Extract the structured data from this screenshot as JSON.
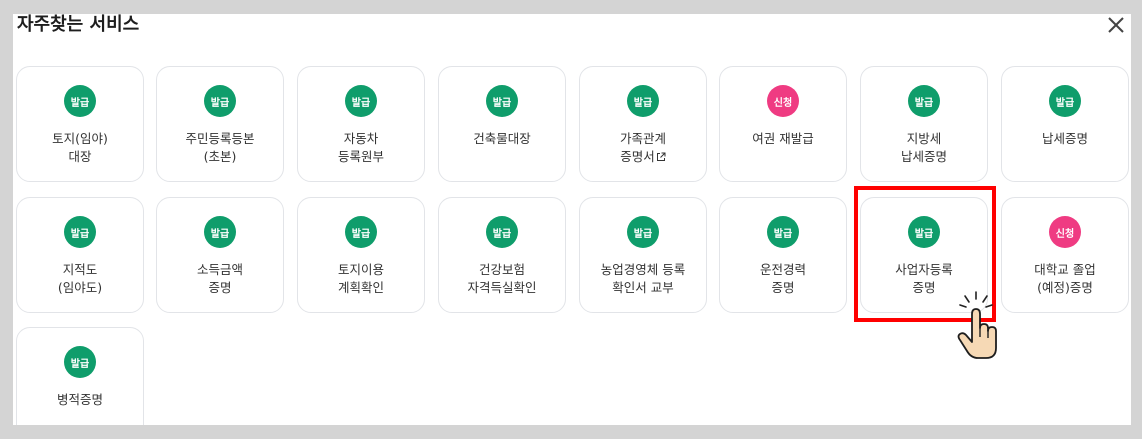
{
  "modal": {
    "title": "자주찾는 서비스",
    "close_icon": "close-icon"
  },
  "cards": [
    {
      "badge": "발급",
      "color": "#0f9d6b",
      "lines": [
        "토지(임야)",
        "대장"
      ]
    },
    {
      "badge": "발급",
      "color": "#0f9d6b",
      "lines": [
        "주민등록등본",
        "(초본)"
      ]
    },
    {
      "badge": "발급",
      "color": "#0f9d6b",
      "lines": [
        "자동차",
        "등록원부"
      ]
    },
    {
      "badge": "발급",
      "color": "#0f9d6b",
      "lines": [
        "건축물대장"
      ]
    },
    {
      "badge": "발급",
      "color": "#0f9d6b",
      "lines": [
        "가족관계",
        "증명서"
      ],
      "external": true
    },
    {
      "badge": "신청",
      "color": "#ef3b82",
      "lines": [
        "여권 재발급"
      ]
    },
    {
      "badge": "발급",
      "color": "#0f9d6b",
      "lines": [
        "지방세",
        "납세증명"
      ]
    },
    {
      "badge": "발급",
      "color": "#0f9d6b",
      "lines": [
        "납세증명"
      ]
    },
    {
      "badge": "발급",
      "color": "#0f9d6b",
      "lines": [
        "지적도",
        "(임야도)"
      ]
    },
    {
      "badge": "발급",
      "color": "#0f9d6b",
      "lines": [
        "소득금액",
        "증명"
      ]
    },
    {
      "badge": "발급",
      "color": "#0f9d6b",
      "lines": [
        "토지이용",
        "계획확인"
      ]
    },
    {
      "badge": "발급",
      "color": "#0f9d6b",
      "lines": [
        "건강보험",
        "자격득실확인"
      ]
    },
    {
      "badge": "발급",
      "color": "#0f9d6b",
      "lines": [
        "농업경영체 등록",
        "확인서 교부"
      ]
    },
    {
      "badge": "발급",
      "color": "#0f9d6b",
      "lines": [
        "운전경력",
        "증명"
      ]
    },
    {
      "badge": "발급",
      "color": "#0f9d6b",
      "lines": [
        "사업자등록",
        "증명"
      ],
      "highlighted": true
    },
    {
      "badge": "신청",
      "color": "#ef3b82",
      "lines": [
        "대학교 졸업",
        "(예정)증명"
      ]
    },
    {
      "badge": "발급",
      "color": "#0f9d6b",
      "lines": [
        "병적증명"
      ]
    }
  ],
  "overlay": {
    "highlight_color": "#ff0000",
    "pointer_icon": "hand-pointer-icon"
  }
}
